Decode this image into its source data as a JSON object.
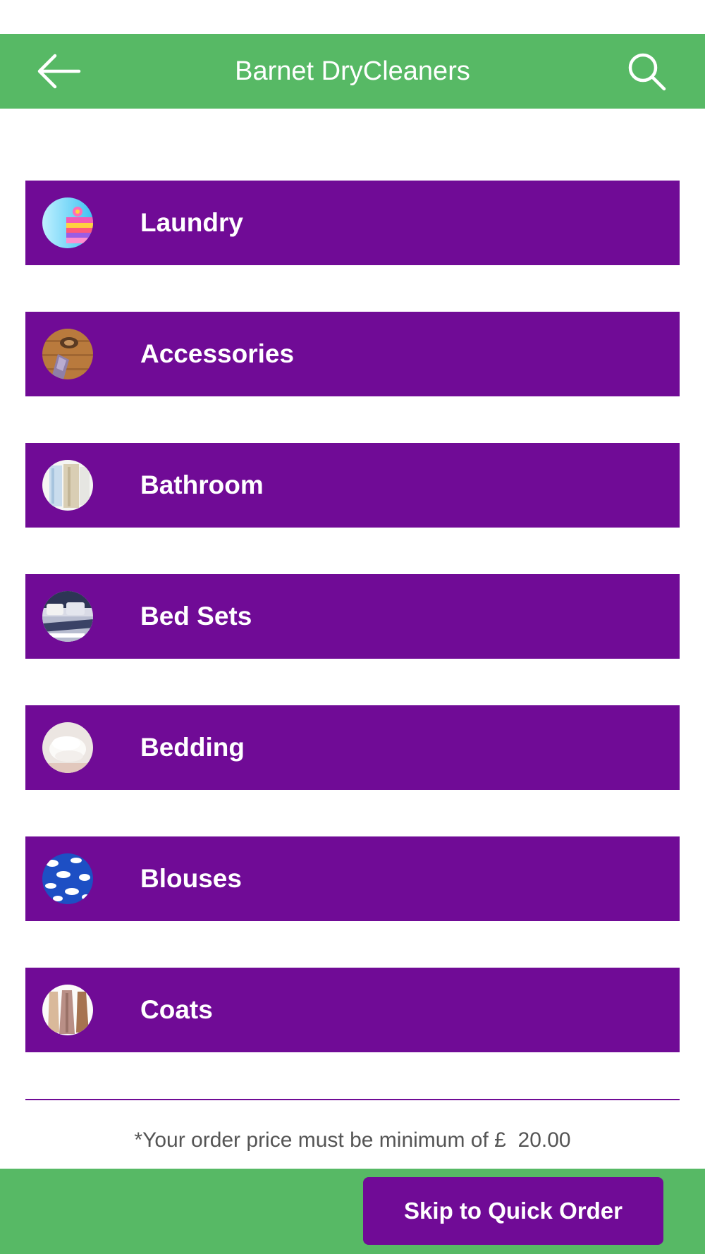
{
  "header": {
    "title": "Barnet DryCleaners",
    "back_icon": "arrow-left-icon",
    "search_icon": "search-icon",
    "background_color": "#57b965"
  },
  "categories": [
    {
      "label": "Laundry",
      "icon": "laundry-thumbnail"
    },
    {
      "label": "Accessories",
      "icon": "accessories-thumbnail"
    },
    {
      "label": "Bathroom",
      "icon": "bathroom-thumbnail"
    },
    {
      "label": "Bed Sets",
      "icon": "bed-sets-thumbnail"
    },
    {
      "label": "Bedding",
      "icon": "bedding-thumbnail"
    },
    {
      "label": "Blouses",
      "icon": "blouses-thumbnail"
    },
    {
      "label": "Coats",
      "icon": "coats-thumbnail"
    }
  ],
  "category_color": "#700b96",
  "footer": {
    "min_order_note": "*Your order price must be minimum of £  20.00",
    "quick_order_label": "Skip to Quick Order",
    "background_color": "#57b965"
  }
}
